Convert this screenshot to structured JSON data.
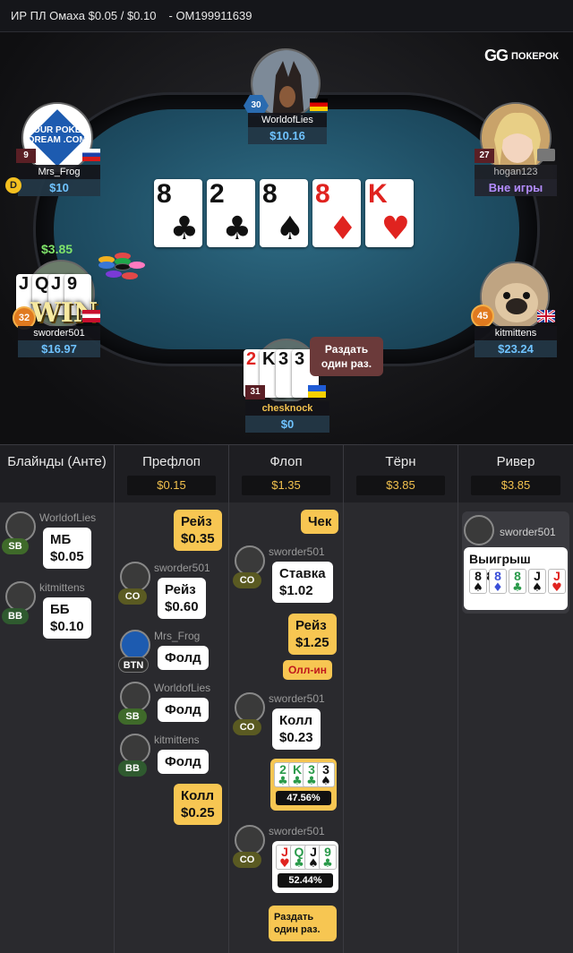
{
  "header": {
    "title": "ИР ПЛ Омаха $0.05 / $0.10",
    "hand_id": "- OM199911639"
  },
  "logo": {
    "mark": "GG",
    "name": "ПОКЕРОК"
  },
  "board": [
    {
      "rank": "8",
      "suit": "♣",
      "color": "#111111"
    },
    {
      "rank": "2",
      "suit": "♣",
      "color": "#111111"
    },
    {
      "rank": "8",
      "suit": "♠",
      "color": "#111111"
    },
    {
      "rank": "8",
      "suit": "♦",
      "color": "#e0231f"
    },
    {
      "rank": "K",
      "suit": "♥",
      "color": "#e0231f"
    }
  ],
  "pot": "$3.85",
  "seats": {
    "worldoflies": {
      "name": "WorldofLies",
      "stack": "$10.16",
      "level": "30"
    },
    "mrsfrog": {
      "name": "Mrs_Frog",
      "stack": "$10",
      "level": "9",
      "dealer": "D",
      "avatar_text": "YOUR POKER DREAM .COM"
    },
    "hogan": {
      "name": "hogan123",
      "stack": "Вне игры",
      "level": "27"
    },
    "sworder": {
      "name": "sworder501",
      "stack": "$16.97",
      "level": "32",
      "win": "WIN",
      "cards": [
        "J",
        "Q",
        "J",
        "9"
      ]
    },
    "kitmittens": {
      "name": "kitmittens",
      "stack": "$23.24",
      "level": "45"
    },
    "chesknock": {
      "name": "chesknock",
      "stack": "$0",
      "level": "31",
      "cards": [
        "2",
        "K",
        "3",
        "3"
      ],
      "tip": "Раздать один раз."
    }
  },
  "history": {
    "columns": [
      {
        "title": "Блайнды (Анте)",
        "amount": ""
      },
      {
        "title": "Префлоп",
        "amount": "$0.15"
      },
      {
        "title": "Флоп",
        "amount": "$1.35"
      },
      {
        "title": "Тёрн",
        "amount": "$3.85"
      },
      {
        "title": "Ривер",
        "amount": "$3.85"
      }
    ],
    "blinds": [
      {
        "name": "WorldofLies",
        "pos": "SB",
        "action": "МБ",
        "amount": "$0.05"
      },
      {
        "name": "kitmittens",
        "pos": "BB",
        "action": "ББ",
        "amount": "$0.10"
      }
    ],
    "preflop": {
      "raise1": {
        "action": "Рейз",
        "amount": "$0.35"
      },
      "co": {
        "name": "sworder501",
        "pos": "CO",
        "action": "Рейз",
        "amount": "$0.60"
      },
      "btn": {
        "name": "Mrs_Frog",
        "pos": "BTN",
        "action": "Фолд"
      },
      "sb": {
        "name": "WorldofLies",
        "pos": "SB",
        "action": "Фолд"
      },
      "bb": {
        "name": "kitmittens",
        "pos": "BB",
        "action": "Фолд"
      },
      "call": {
        "action": "Колл",
        "amount": "$0.25"
      }
    },
    "flop": {
      "check": {
        "action": "Чек"
      },
      "bet": {
        "name": "sworder501",
        "pos": "CO",
        "action": "Ставка",
        "amount": "$1.02"
      },
      "raise": {
        "action": "Рейз",
        "amount": "$1.25"
      },
      "allin": "Олл-ин",
      "call": {
        "name": "sworder501",
        "pos": "CO",
        "action": "Колл",
        "amount": "$0.23"
      },
      "hero_hand": {
        "cards": [
          {
            "rank": "2",
            "suit": "♣",
            "color": "#2a9a4a"
          },
          {
            "rank": "K",
            "suit": "♣",
            "color": "#2a9a4a"
          },
          {
            "rank": "3",
            "suit": "♣",
            "color": "#2a9a4a"
          },
          {
            "rank": "3",
            "suit": "♠",
            "color": "#111111"
          }
        ],
        "equity": "47.56%"
      },
      "villain": {
        "name": "sworder501",
        "pos": "CO",
        "cards": [
          {
            "rank": "J",
            "suit": "♥",
            "color": "#e0231f"
          },
          {
            "rank": "Q",
            "suit": "♣",
            "color": "#2a9a4a"
          },
          {
            "rank": "J",
            "suit": "♠",
            "color": "#111111"
          },
          {
            "rank": "9",
            "suit": "♣",
            "color": "#2a9a4a"
          }
        ],
        "equity": "52.44%"
      },
      "deal_once": "Раздать один раз."
    },
    "river": {
      "winner": "sworder501",
      "win_text": "Выигрыш $3.85",
      "cards": [
        {
          "rank": "8",
          "suit": "♠",
          "color": "#111111"
        },
        {
          "rank": "8",
          "suit": "♦",
          "color": "#3a4fd8"
        },
        {
          "rank": "8",
          "suit": "♣",
          "color": "#2a9a4a"
        },
        {
          "rank": "J",
          "suit": "♠",
          "color": "#111111"
        },
        {
          "rank": "J",
          "suit": "♥",
          "color": "#e0231f"
        }
      ]
    }
  }
}
